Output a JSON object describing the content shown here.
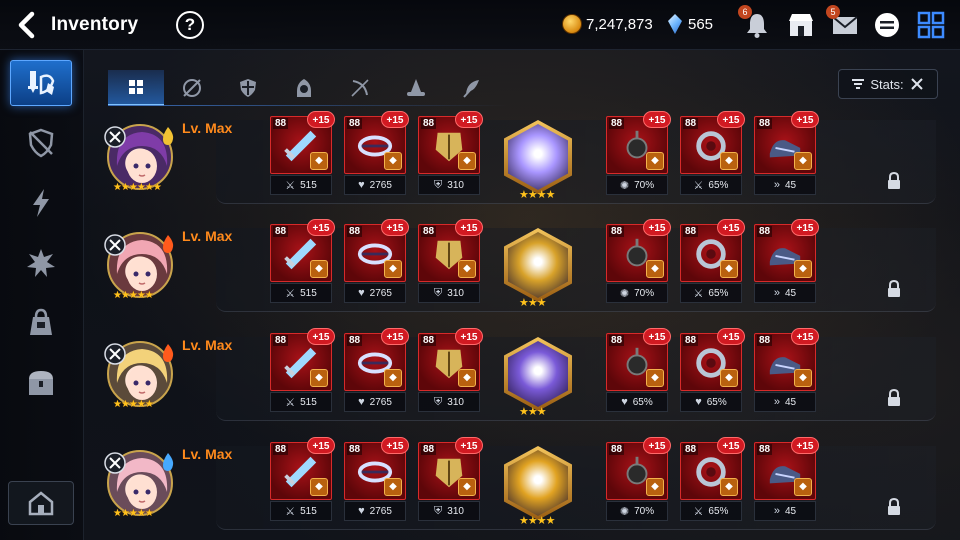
{
  "header": {
    "title": "Inventory",
    "help_label": "?",
    "gold": "7,247,873",
    "crystals": "565",
    "notif_badge": "6",
    "mail_badge": "5"
  },
  "sidebar": {
    "items": [
      {
        "name": "equipment",
        "active": true
      },
      {
        "name": "artifact"
      },
      {
        "name": "catalyst"
      },
      {
        "name": "material"
      },
      {
        "name": "misc"
      },
      {
        "name": "storage"
      }
    ]
  },
  "tabs": [
    {
      "name": "all",
      "active": true
    },
    {
      "name": "knight"
    },
    {
      "name": "warrior"
    },
    {
      "name": "thief"
    },
    {
      "name": "ranger"
    },
    {
      "name": "mage"
    },
    {
      "name": "soul-weaver"
    }
  ],
  "stats_button": "Stats:",
  "rows": [
    {
      "level": "Lv. Max",
      "class_icon": "soul-weaver-icon",
      "element_icon": "light-icon",
      "element_color": "#f2c233",
      "hair": "#7f3ca8",
      "portrait_bg": "#4a2a66",
      "hero_stars": "★★★★★★",
      "artifact_stars": "★★★★",
      "artifact_color": "#a996ff",
      "items": [
        {
          "ilvl": "88",
          "enh": "+15",
          "stat": "515",
          "stat_icon": "attack"
        },
        {
          "ilvl": "88",
          "enh": "+15",
          "stat": "2765",
          "stat_icon": "health"
        },
        {
          "ilvl": "88",
          "enh": "+15",
          "stat": "310",
          "stat_icon": "defense"
        },
        {
          "ilvl": "88",
          "enh": "+15",
          "stat": "70%",
          "stat_icon": "crit"
        },
        {
          "ilvl": "88",
          "enh": "+15",
          "stat": "65%",
          "stat_icon": "attack"
        },
        {
          "ilvl": "88",
          "enh": "+15",
          "stat": "45",
          "stat_icon": "speed"
        }
      ]
    },
    {
      "level": "Lv. Max",
      "class_icon": "mage-icon",
      "element_icon": "fire-icon",
      "element_color": "#ff5a1c",
      "hair": "#f1a6b3",
      "portrait_bg": "#6a3a3e",
      "hero_stars": "★★★★★",
      "artifact_stars": "★★★",
      "artifact_color": "#d8a22a",
      "items": [
        {
          "ilvl": "88",
          "enh": "+15",
          "stat": "515",
          "stat_icon": "attack"
        },
        {
          "ilvl": "88",
          "enh": "+15",
          "stat": "2765",
          "stat_icon": "health"
        },
        {
          "ilvl": "88",
          "enh": "+15",
          "stat": "310",
          "stat_icon": "defense"
        },
        {
          "ilvl": "88",
          "enh": "+15",
          "stat": "70%",
          "stat_icon": "crit"
        },
        {
          "ilvl": "88",
          "enh": "+15",
          "stat": "65%",
          "stat_icon": "attack"
        },
        {
          "ilvl": "88",
          "enh": "+15",
          "stat": "45",
          "stat_icon": "speed"
        }
      ]
    },
    {
      "level": "Lv. Max",
      "class_icon": "knight-icon",
      "element_icon": "fire-icon",
      "element_color": "#ff5a1c",
      "hair": "#f3d27a",
      "portrait_bg": "#5b4a3a",
      "hero_stars": "★★★★★",
      "artifact_stars": "★★★",
      "artifact_color": "#7a5ad8",
      "items": [
        {
          "ilvl": "88",
          "enh": "+15",
          "stat": "515",
          "stat_icon": "attack"
        },
        {
          "ilvl": "88",
          "enh": "+15",
          "stat": "2765",
          "stat_icon": "health"
        },
        {
          "ilvl": "88",
          "enh": "+15",
          "stat": "310",
          "stat_icon": "defense"
        },
        {
          "ilvl": "88",
          "enh": "+15",
          "stat": "65%",
          "stat_icon": "health"
        },
        {
          "ilvl": "88",
          "enh": "+15",
          "stat": "65%",
          "stat_icon": "health"
        },
        {
          "ilvl": "88",
          "enh": "+15",
          "stat": "45",
          "stat_icon": "speed"
        }
      ]
    },
    {
      "level": "Lv. Max",
      "class_icon": "soul-weaver-icon",
      "element_icon": "ice-icon",
      "element_color": "#47a9ff",
      "hair": "#f2b8c7",
      "portrait_bg": "#6a4c5a",
      "hero_stars": "★★★★★",
      "artifact_stars": "★★★★",
      "artifact_color": "#e1a322",
      "items": [
        {
          "ilvl": "88",
          "enh": "+15",
          "stat": "515",
          "stat_icon": "attack"
        },
        {
          "ilvl": "88",
          "enh": "+15",
          "stat": "2765",
          "stat_icon": "health"
        },
        {
          "ilvl": "88",
          "enh": "+15",
          "stat": "310",
          "stat_icon": "defense"
        },
        {
          "ilvl": "88",
          "enh": "+15",
          "stat": "70%",
          "stat_icon": "crit"
        },
        {
          "ilvl": "88",
          "enh": "+15",
          "stat": "65%",
          "stat_icon": "attack"
        },
        {
          "ilvl": "88",
          "enh": "+15",
          "stat": "45",
          "stat_icon": "speed"
        }
      ]
    }
  ]
}
